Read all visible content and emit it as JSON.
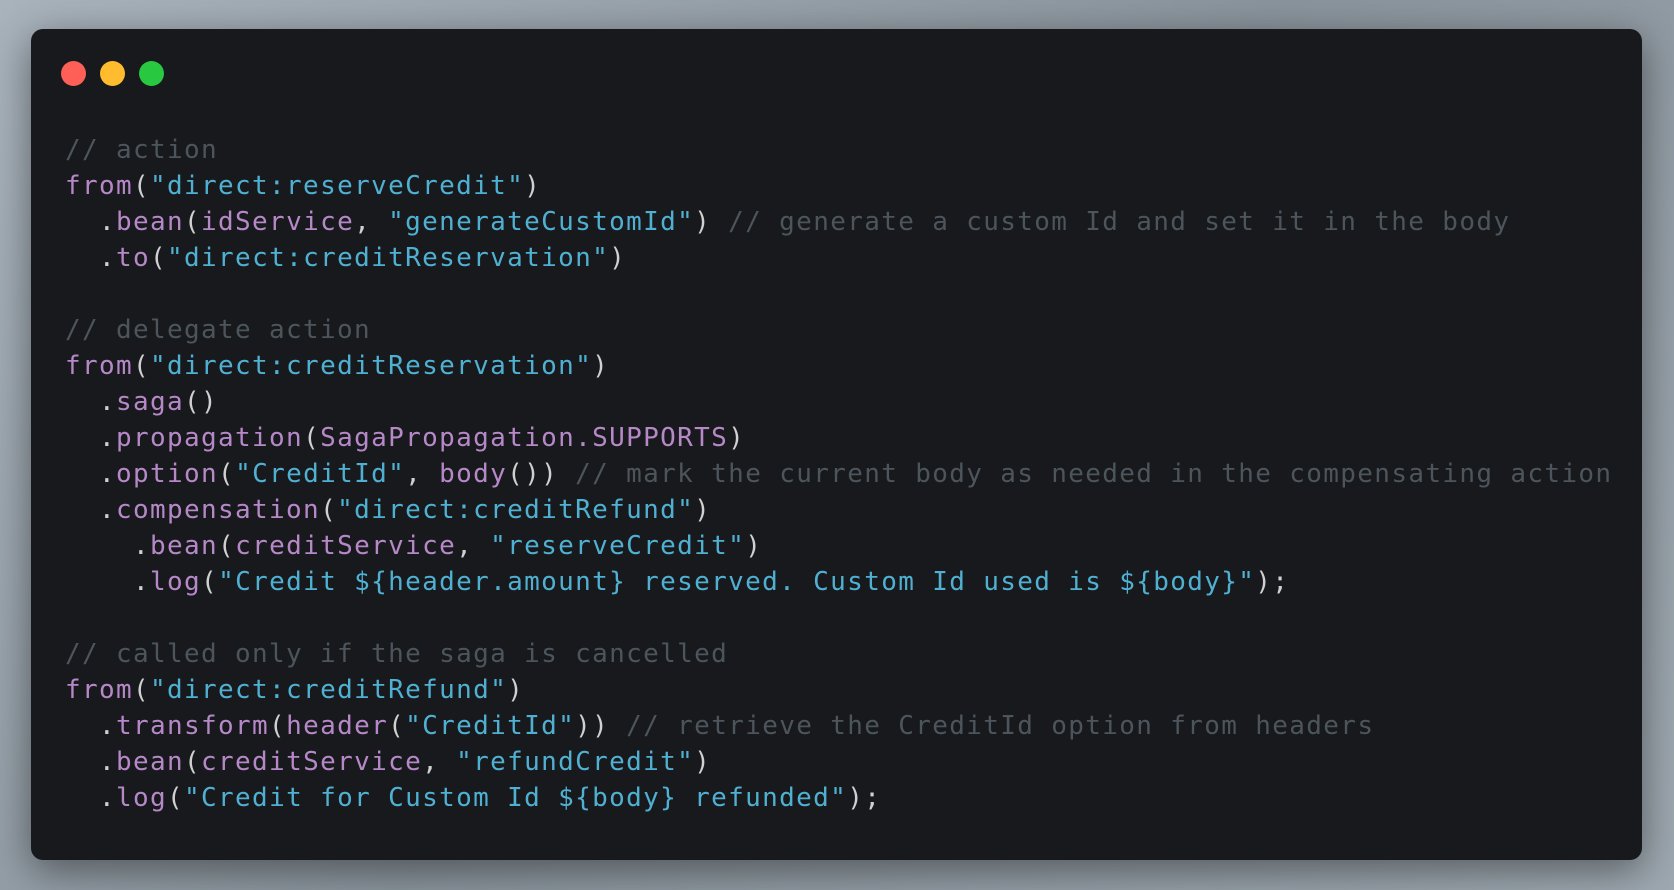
{
  "window": {
    "controls": [
      {
        "name": "close",
        "color": "#fe5f57"
      },
      {
        "name": "minimize",
        "color": "#febc2e"
      },
      {
        "name": "maximize",
        "color": "#28c840"
      }
    ]
  },
  "code": {
    "lines": [
      [
        [
          "com",
          "// action"
        ]
      ],
      [
        [
          "kw",
          "from"
        ],
        [
          "pun",
          "("
        ],
        [
          "str",
          "\"direct:reserveCredit\""
        ],
        [
          "pun",
          ")"
        ]
      ],
      [
        [
          "pun",
          "  ."
        ],
        [
          "kw",
          "bean"
        ],
        [
          "pun",
          "("
        ],
        [
          "kw",
          "idService"
        ],
        [
          "pun",
          ", "
        ],
        [
          "str",
          "\"generateCustomId\""
        ],
        [
          "pun",
          ") "
        ],
        [
          "com",
          "// generate a custom Id and set it in the body"
        ]
      ],
      [
        [
          "pun",
          "  ."
        ],
        [
          "kw",
          "to"
        ],
        [
          "pun",
          "("
        ],
        [
          "str",
          "\"direct:creditReservation\""
        ],
        [
          "pun",
          ")"
        ]
      ],
      [],
      [
        [
          "com",
          "// delegate action"
        ]
      ],
      [
        [
          "kw",
          "from"
        ],
        [
          "pun",
          "("
        ],
        [
          "str",
          "\"direct:creditReservation\""
        ],
        [
          "pun",
          ")"
        ]
      ],
      [
        [
          "pun",
          "  ."
        ],
        [
          "kw",
          "saga"
        ],
        [
          "pun",
          "()"
        ]
      ],
      [
        [
          "pun",
          "  ."
        ],
        [
          "kw",
          "propagation"
        ],
        [
          "pun",
          "("
        ],
        [
          "kw",
          "SagaPropagation.SUPPORTS"
        ],
        [
          "pun",
          ")"
        ]
      ],
      [
        [
          "pun",
          "  ."
        ],
        [
          "kw",
          "option"
        ],
        [
          "pun",
          "("
        ],
        [
          "str",
          "\"CreditId\""
        ],
        [
          "pun",
          ", "
        ],
        [
          "kw",
          "body"
        ],
        [
          "pun",
          "()) "
        ],
        [
          "com",
          "// mark the current body as needed in the compensating action"
        ]
      ],
      [
        [
          "pun",
          "  ."
        ],
        [
          "kw",
          "compensation"
        ],
        [
          "pun",
          "("
        ],
        [
          "str",
          "\"direct:creditRefund\""
        ],
        [
          "pun",
          ")"
        ]
      ],
      [
        [
          "pun",
          "    ."
        ],
        [
          "kw",
          "bean"
        ],
        [
          "pun",
          "("
        ],
        [
          "kw",
          "creditService"
        ],
        [
          "pun",
          ", "
        ],
        [
          "str",
          "\"reserveCredit\""
        ],
        [
          "pun",
          ")"
        ]
      ],
      [
        [
          "pun",
          "    ."
        ],
        [
          "kw",
          "log"
        ],
        [
          "pun",
          "("
        ],
        [
          "str",
          "\"Credit ${header.amount} reserved. Custom Id used is ${body}\""
        ],
        [
          "pun",
          ");"
        ]
      ],
      [],
      [
        [
          "com",
          "// called only if the saga is cancelled"
        ]
      ],
      [
        [
          "kw",
          "from"
        ],
        [
          "pun",
          "("
        ],
        [
          "str",
          "\"direct:creditRefund\""
        ],
        [
          "pun",
          ")"
        ]
      ],
      [
        [
          "pun",
          "  ."
        ],
        [
          "kw",
          "transform"
        ],
        [
          "pun",
          "("
        ],
        [
          "kw",
          "header"
        ],
        [
          "pun",
          "("
        ],
        [
          "str",
          "\"CreditId\""
        ],
        [
          "pun",
          ")) "
        ],
        [
          "com",
          "// retrieve the CreditId option from headers"
        ]
      ],
      [
        [
          "pun",
          "  ."
        ],
        [
          "kw",
          "bean"
        ],
        [
          "pun",
          "("
        ],
        [
          "kw",
          "creditService"
        ],
        [
          "pun",
          ", "
        ],
        [
          "str",
          "\"refundCredit\""
        ],
        [
          "pun",
          ")"
        ]
      ],
      [
        [
          "pun",
          "  ."
        ],
        [
          "kw",
          "log"
        ],
        [
          "pun",
          "("
        ],
        [
          "str",
          "\"Credit for Custom Id ${body} refunded\""
        ],
        [
          "pun",
          ");"
        ]
      ]
    ]
  }
}
